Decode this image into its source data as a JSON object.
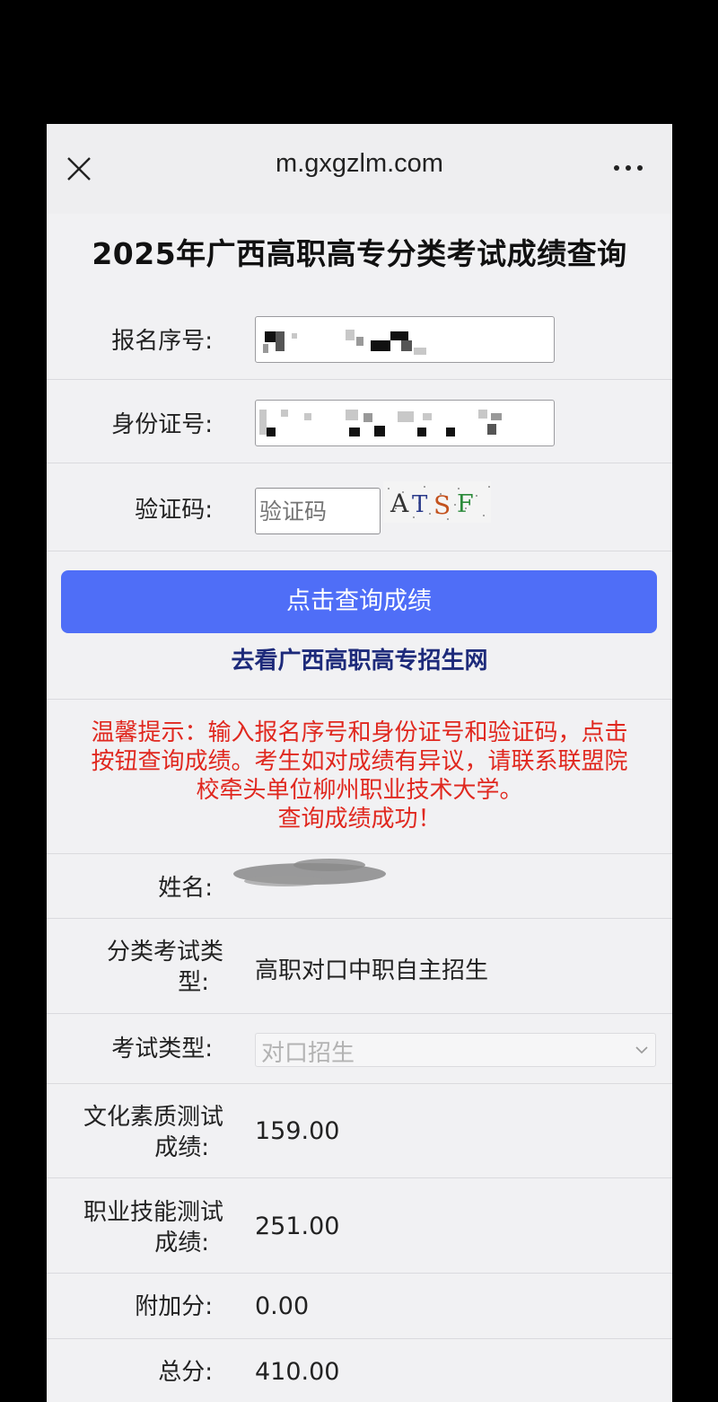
{
  "browser": {
    "url": "m.gxgzlm.com"
  },
  "page": {
    "title": "2025年广西高职高专分类考试成绩查询"
  },
  "form": {
    "reg_no_label": "报名序号:",
    "id_no_label": "身份证号:",
    "captcha_label": "验证码:",
    "captcha_placeholder": "验证码",
    "captcha_text": "ATSF",
    "submit_label": "点击查询成绩",
    "link_label": "去看广西高职高专招生网"
  },
  "notice": {
    "lines": [
      "温馨提示：输入报名序号和身份证号和验证码，点击",
      "按钮查询成绩。考生如对成绩有异议，请联系联盟院",
      "校牵头单位柳州职业技术大学。",
      "查询成绩成功！"
    ]
  },
  "result": {
    "name_label": "姓名:",
    "category_label_1": "分类考试类",
    "category_label_2": "型:",
    "category_value": "高职对口中职自主招生",
    "exam_type_label": "考试类型:",
    "exam_type_value": "对口招生",
    "culture_label_1": "文化素质测试",
    "culture_label_2": "成绩:",
    "culture_value": "159.00",
    "skill_label_1": "职业技能测试",
    "skill_label_2": "成绩:",
    "skill_value": "251.00",
    "bonus_label": "附加分:",
    "bonus_value": "0.00",
    "total_label": "总分:",
    "total_value": "410.00"
  },
  "icons": {
    "close": "close-icon",
    "more": "more-icon",
    "select_arrow": "chevron-down-icon"
  },
  "colors": {
    "button": "#4f6ef7",
    "link": "#1d2a7a",
    "notice": "#e0281f"
  }
}
